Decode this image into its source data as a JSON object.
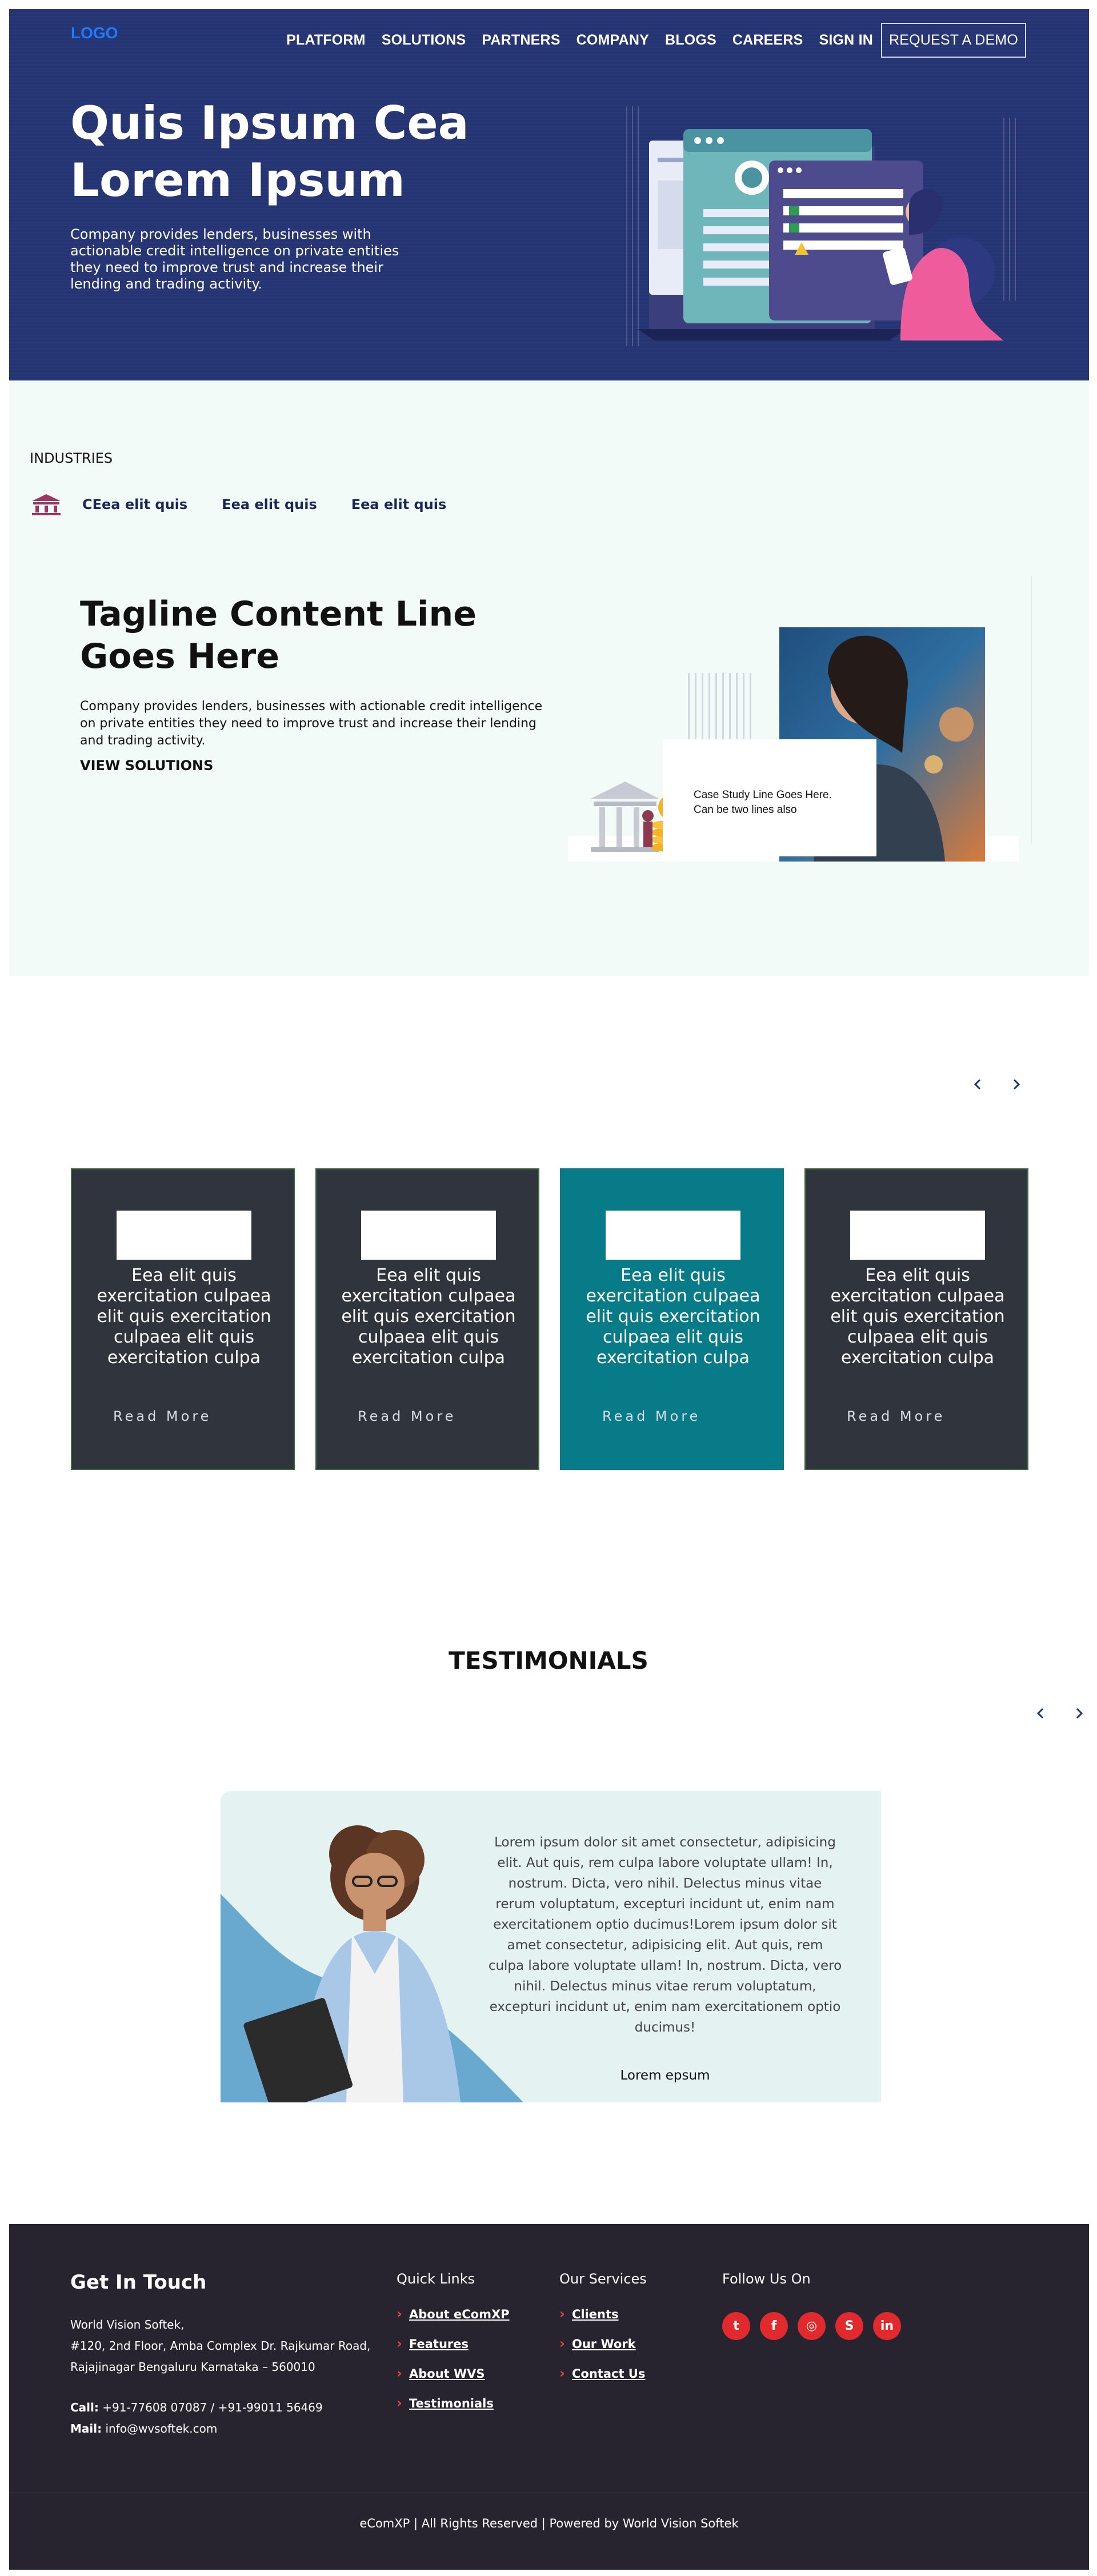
{
  "nav": {
    "logo": "LOGO",
    "items": [
      "PLATFORM",
      "SOLUTIONS",
      "PARTNERS",
      "COMPANY",
      "BLOGS",
      "CAREERS",
      "SIGN IN"
    ],
    "demo_label": "REQUEST A DEMO"
  },
  "hero": {
    "title": "Quis Ipsum Cea Lorem Ipsum",
    "description": "Company provides lenders, businesses with actionable credit intelligence on private entities they need to improve trust and increase their lending and trading activity."
  },
  "industries": {
    "label": "INDUSTRIES",
    "tabs": [
      "CEea elit quis",
      "Eea elit quis",
      "Eea elit quis"
    ],
    "tagline": "Tagline Content Line Goes Here",
    "description": "Company provides lenders, businesses with actionable credit intelligence on private entities they need to improve trust and increase their lending and trading activity.",
    "link": "VIEW SOLUTIONS",
    "case_study": "Case Study Line Goes Here. Can be two lines also"
  },
  "cards": [
    {
      "title": "Eea elit quis exercitation culpaea elit quis exercitation culpaea elit quis exercitation culpa",
      "more": "Read More"
    },
    {
      "title": "Eea elit quis exercitation culpaea elit quis exercitation culpaea elit quis exercitation culpa",
      "more": "Read More"
    },
    {
      "title": "Eea elit quis exercitation culpaea elit quis exercitation culpaea elit quis exercitation culpa",
      "more": "Read More"
    },
    {
      "title": "Eea elit quis exercitation culpaea elit quis exercitation culpaea elit quis exercitation culpa",
      "more": "Read More"
    }
  ],
  "testimonials": {
    "heading": "TESTIMONIALS",
    "quote": "Lorem ipsum dolor sit amet consectetur, adipisicing elit. Aut quis, rem culpa labore voluptate ullam! In, nostrum. Dicta, vero nihil. Delectus minus vitae rerum voluptatum, excepturi incidunt ut, enim nam exercitationem optio ducimus!Lorem ipsum dolor sit amet consectetur, adipisicing elit. Aut quis, rem culpa labore voluptate ullam! In, nostrum. Dicta, vero nihil. Delectus minus vitae rerum voluptatum, excepturi incidunt ut, enim nam exercitationem optio ducimus!",
    "name": "Lorem epsum"
  },
  "footer": {
    "contact_heading": "Get In Touch",
    "company": "World Vision Softek,",
    "address_1": "#120, 2nd Floor, Amba Complex Dr. Rajkumar Road,",
    "address_2": "Rajajinagar Bengaluru Karnataka – 560010",
    "call_label": "Call:",
    "call": "+91-77608 07087 / +91-99011 56469",
    "mail_label": "Mail:",
    "mail": "info@wvsoftek.com",
    "quick_links_title": "Quick Links",
    "quick_links": [
      "About eComXP",
      "Features",
      "About WVS",
      "Testimonials"
    ],
    "services_title": "Our Services",
    "services": [
      "Clients",
      "Our Work",
      "Contact Us"
    ],
    "follow_title": "Follow Us On",
    "social_icons": [
      "twitter-icon",
      "facebook-icon",
      "instagram-icon",
      "skype-icon",
      "linkedin-icon"
    ],
    "copyright": "eComXP | All Rights Reserved | Powered by World Vision Softek"
  },
  "colors": {
    "hero_bg": "#253472",
    "logo_blue": "#1e7cff",
    "section_mint": "#f3fbf9",
    "card_dark": "#30353d",
    "card_active": "#087b88",
    "footer_bg": "#27242f",
    "social_red": "#e02a2e"
  }
}
